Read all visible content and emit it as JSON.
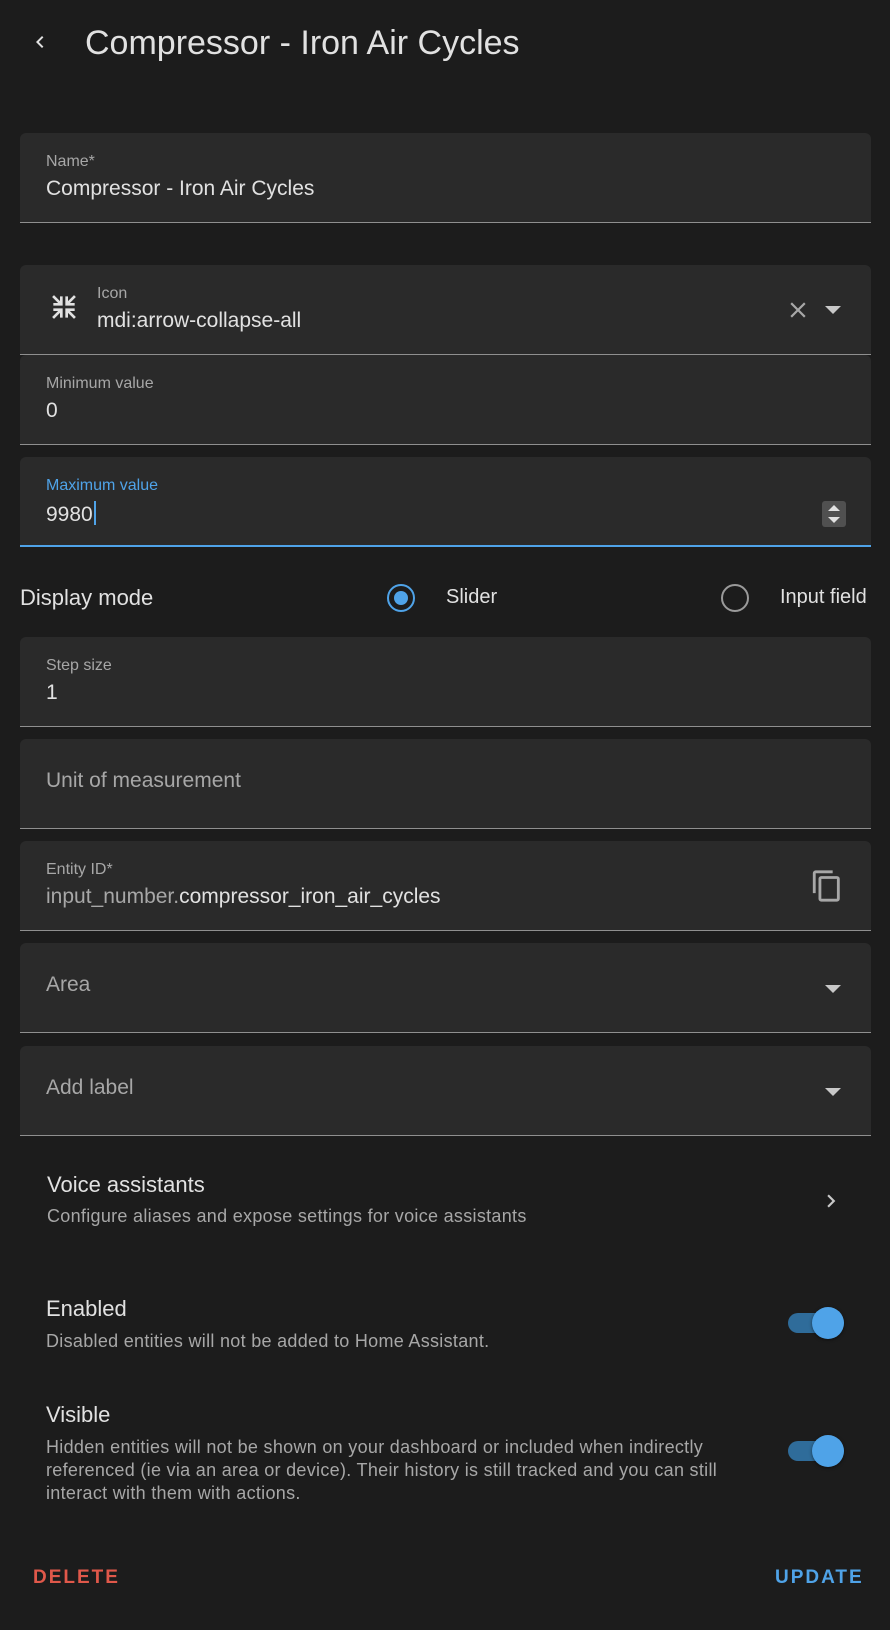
{
  "header": {
    "title": "Compressor - Iron Air Cycles"
  },
  "name_field": {
    "label": "Name*",
    "value": "Compressor - Iron Air Cycles"
  },
  "icon_field": {
    "label": "Icon",
    "value": "mdi:arrow-collapse-all",
    "icon": "arrow-collapse-all-icon"
  },
  "min_field": {
    "label": "Minimum value",
    "value": "0"
  },
  "max_field": {
    "label": "Maximum value",
    "value": "9980"
  },
  "display_mode": {
    "label": "Display mode",
    "options": [
      {
        "label": "Slider",
        "checked": true
      },
      {
        "label": "Input field",
        "checked": false
      }
    ]
  },
  "step_field": {
    "label": "Step size",
    "value": "1"
  },
  "unit_field": {
    "placeholder": "Unit of measurement"
  },
  "entity_field": {
    "label": "Entity ID*",
    "prefix": "input_number.",
    "value": "compressor_iron_air_cycles"
  },
  "area_field": {
    "placeholder": "Area"
  },
  "label_field": {
    "placeholder": "Add label"
  },
  "voice": {
    "title": "Voice assistants",
    "subtitle": "Configure aliases and expose settings for voice assistants"
  },
  "enabled": {
    "title": "Enabled",
    "subtitle": "Disabled entities will not be added to Home Assistant.",
    "on": true
  },
  "visible": {
    "title": "Visible",
    "subtitle": "Hidden entities will not be shown on your dashboard or included when indirectly referenced (ie via an area or device). Their history is still tracked and you can still interact with them with actions.",
    "on": true
  },
  "actions": {
    "delete_label": "DELETE",
    "update_label": "UPDATE"
  },
  "colors": {
    "accent": "#4fa3e8",
    "danger": "#e0584a",
    "background": "#1c1c1c",
    "field_bg": "#2a2a2a"
  }
}
